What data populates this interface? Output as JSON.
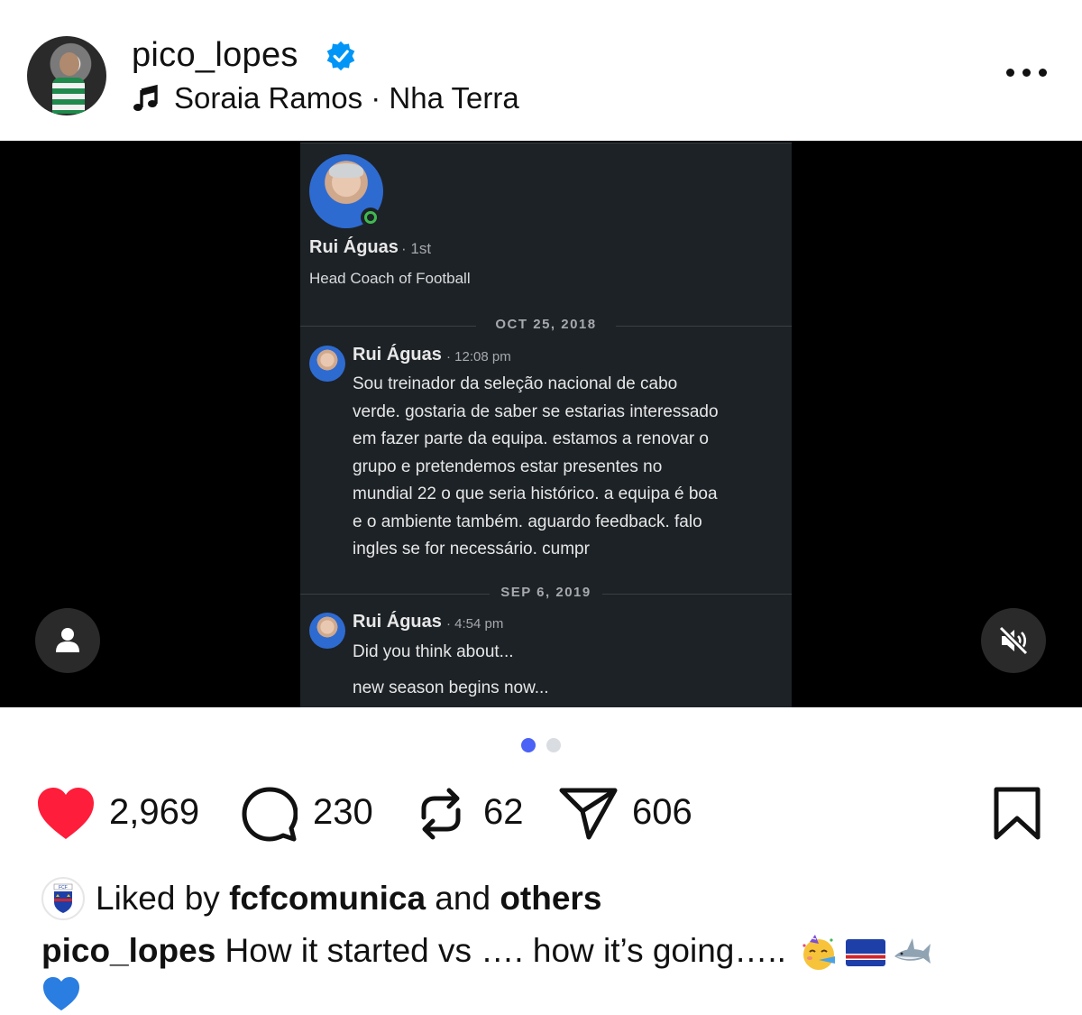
{
  "post": {
    "username": "pico_lopes",
    "audio": "Soraia Ramos · Nha Terra"
  },
  "media": {
    "profile": {
      "name": "Rui Águas",
      "degree": "· 1st",
      "headline": "Head Coach of Football"
    },
    "messages": [
      {
        "date": "OCT 25, 2018",
        "sender": "Rui Águas",
        "time": "· 12:08 pm",
        "lines": [
          "Sou treinador da seleção nacional de cabo",
          "verde. gostaria de saber se estarias interessado",
          "em fazer parte da equipa. estamos a renovar o",
          "grupo e pretendemos estar presentes no",
          "mundial 22 o que seria histórico. a equipa é boa",
          "e o ambiente também. aguardo feedback. falo",
          "ingles se for necessário. cumpr"
        ]
      },
      {
        "date": "SEP 6, 2019",
        "sender": "Rui Águas",
        "time": "· 4:54 pm",
        "lines": [
          "Did you think about...",
          "new season begins now..."
        ]
      }
    ],
    "carousel": {
      "total": 2,
      "active": 1
    }
  },
  "actions": {
    "likes": "2,969",
    "comments": "230",
    "reposts": "62",
    "shares": "606"
  },
  "liked_by": {
    "prefix": "Liked by ",
    "user": "fcfcomunica",
    "middle": " and ",
    "others": "others"
  },
  "caption": {
    "username": "pico_lopes",
    "text": " How it started vs …. how it’s going….. "
  },
  "icons": [
    "verified-icon",
    "music-note-icon",
    "more-icon",
    "user-tag-icon",
    "mute-icon",
    "heart-icon",
    "comment-icon",
    "repost-icon",
    "share-icon",
    "bookmark-icon"
  ],
  "colors": {
    "like": "#fe1d3a",
    "verified": "#0095f6",
    "active_dot": "#4a62f5",
    "inactive_dot": "#d9dde1",
    "screen_bg": "#1d2226"
  }
}
